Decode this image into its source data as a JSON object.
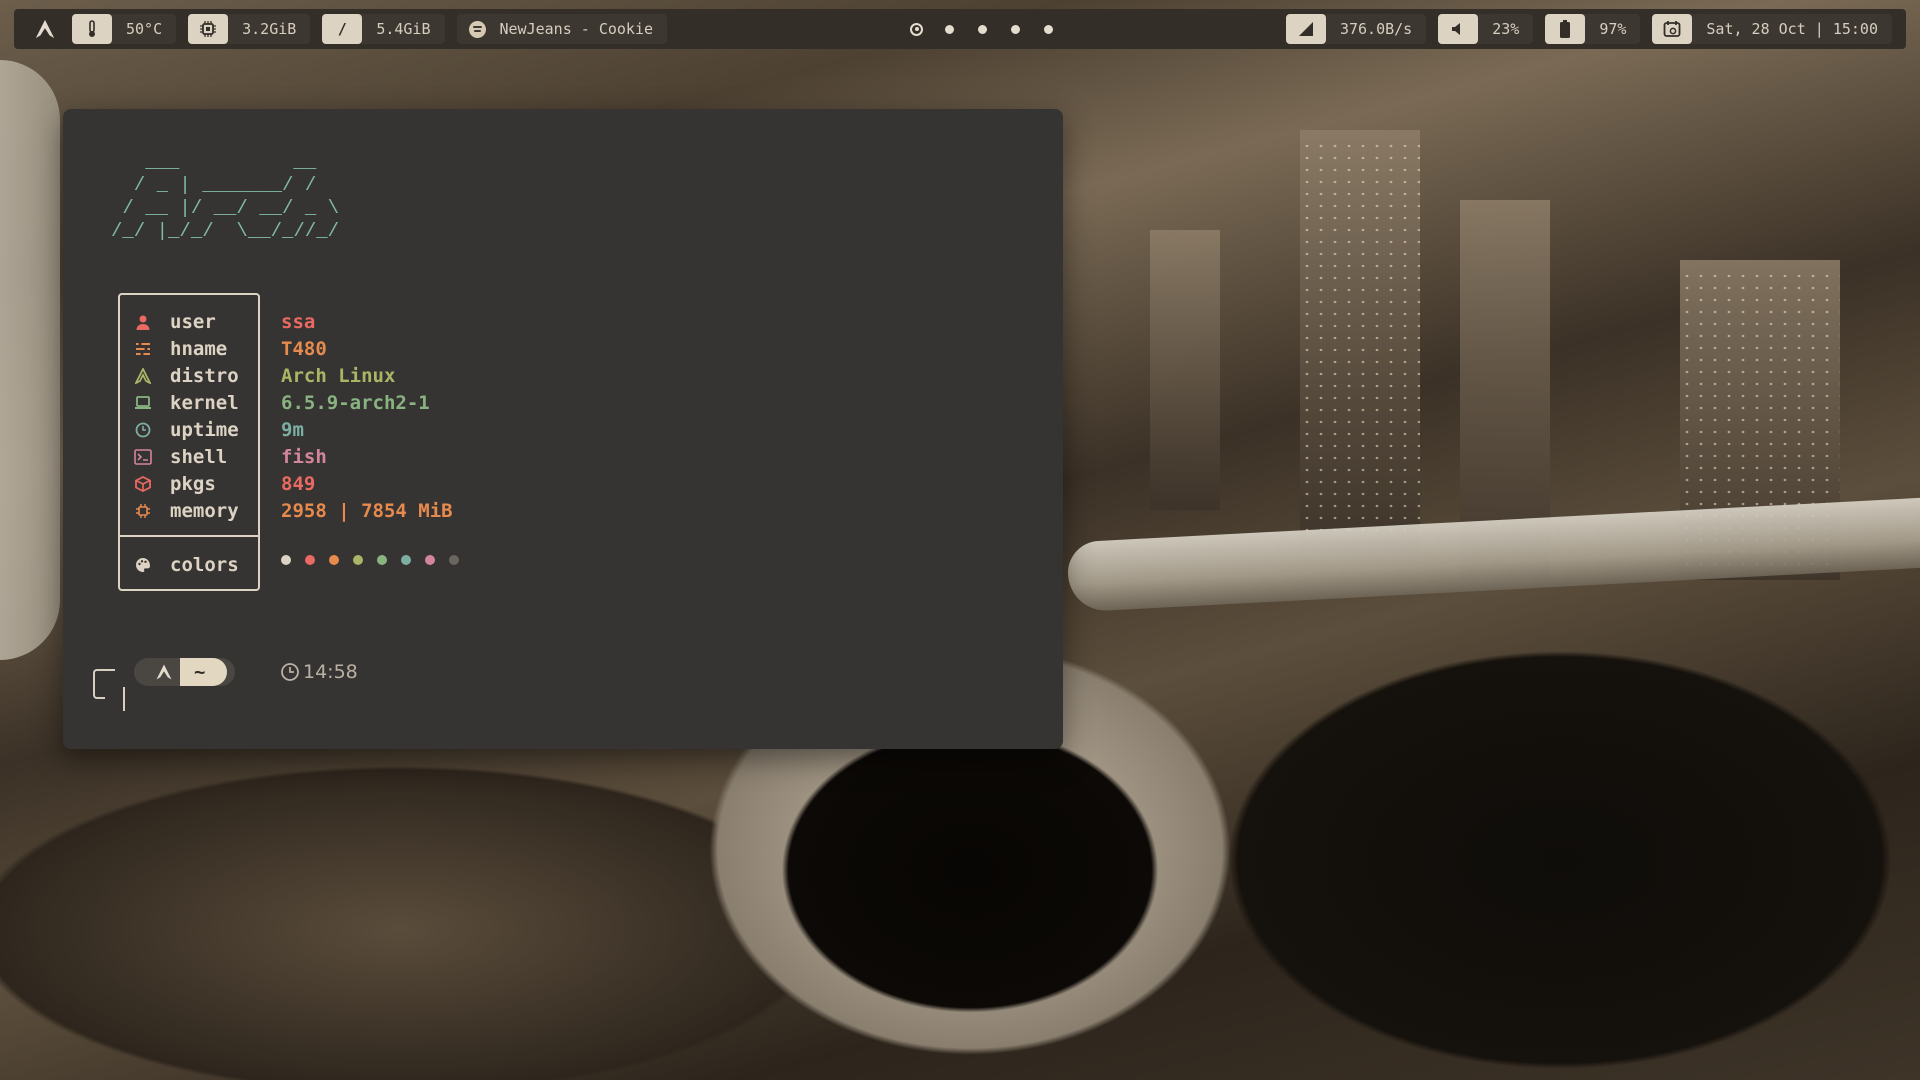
{
  "topbar": {
    "temperature": "50°C",
    "memory": "3.2GiB",
    "disk_icon": "/",
    "disk": "5.4GiB",
    "now_playing": "NewJeans - Cookie",
    "network": "376.0B/s",
    "volume": "23%",
    "battery": "97%",
    "datetime": "Sat, 28 Oct | 15:00",
    "workspaces": [
      "active",
      "occupied",
      "occupied",
      "occupied",
      "occupied"
    ]
  },
  "fetch": {
    "ascii_logo": "   ___          __\n  / _ | _______/ /\n / __ |/ __/ __/ _ \\\n/_/ |_/_/  \\__/_//_/",
    "rows": [
      {
        "key": "user",
        "value": "ssa",
        "icon": "user-icon",
        "color": "#ea6962"
      },
      {
        "key": "hname",
        "value": "T480",
        "icon": "host-icon",
        "color": "#e78a4e"
      },
      {
        "key": "distro",
        "value": "Arch Linux",
        "icon": "distro-icon",
        "color": "#a9b665"
      },
      {
        "key": "kernel",
        "value": "6.5.9-arch2-1",
        "icon": "laptop-icon",
        "color": "#89b482"
      },
      {
        "key": "uptime",
        "value": "9m",
        "icon": "clock-icon",
        "color": "#7daea3"
      },
      {
        "key": "shell",
        "value": "fish",
        "icon": "terminal-icon",
        "color": "#d3869b"
      },
      {
        "key": "pkgs",
        "value": "849",
        "icon": "package-icon",
        "color": "#ea6962"
      },
      {
        "key": "memory",
        "value": "2958 | 7854 MiB",
        "icon": "chip-icon",
        "color": "#e78a4e"
      }
    ],
    "colors_label": "colors",
    "swatches": [
      "#ddd3c4",
      "#ea6962",
      "#e78a4e",
      "#a9b665",
      "#89b482",
      "#7daea3",
      "#d3869b",
      "#6b6560"
    ]
  },
  "prompt": {
    "directory": "~",
    "time": "14:58"
  }
}
